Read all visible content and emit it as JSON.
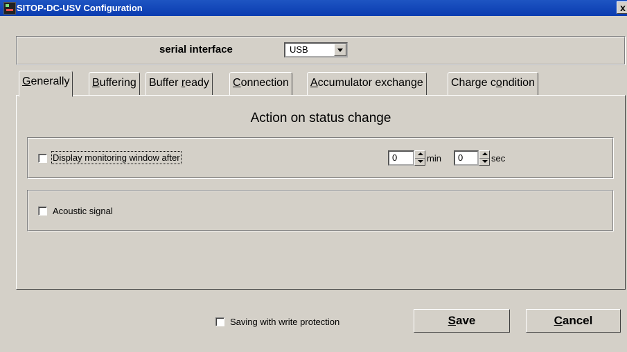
{
  "window": {
    "title": "SITOP-DC-USV Configuration",
    "close_label": "x"
  },
  "serial": {
    "label": "serial interface",
    "value": "USB"
  },
  "tabs": [
    {
      "pre": "",
      "key": "G",
      "post": "enerally",
      "active": true
    },
    {
      "pre": "",
      "key": "B",
      "post": "uffering"
    },
    {
      "pre": "Buffer ",
      "key": "r",
      "post": "eady"
    },
    {
      "pre": "",
      "key": "C",
      "post": "onnection"
    },
    {
      "pre": "",
      "key": "A",
      "post": "ccumulator exchange"
    },
    {
      "pre": "Charge c",
      "key": "o",
      "post": "ndition"
    }
  ],
  "panel": {
    "heading": "Action on status change",
    "display_window": {
      "label": "Display monitoring window after",
      "checked": false,
      "min_value": "0",
      "min_unit": "min",
      "sec_value": "0",
      "sec_unit": "sec"
    },
    "acoustic": {
      "label": "Acoustic signal",
      "checked": false
    }
  },
  "footer": {
    "write_protect_label": "Saving with write protection",
    "write_protect_checked": false,
    "save": {
      "key": "S",
      "rest": "ave"
    },
    "cancel": {
      "key": "C",
      "rest": "ancel"
    }
  },
  "icons": {
    "app": "app-icon",
    "close": "close-icon",
    "dropdown": "chevron-down-icon",
    "spin_up": "arrow-up-icon",
    "spin_down": "arrow-down-icon"
  }
}
